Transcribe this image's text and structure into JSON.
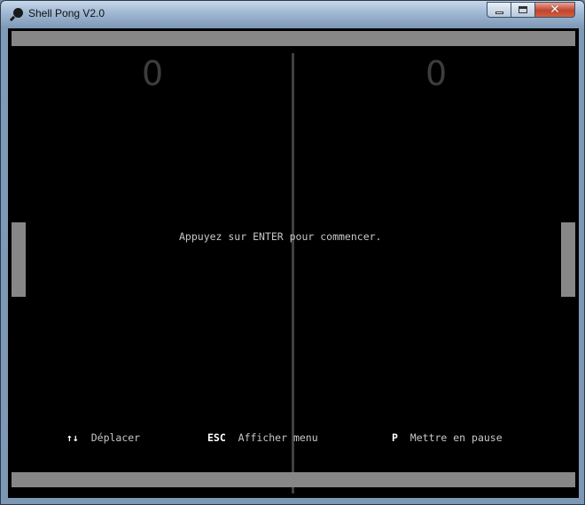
{
  "window": {
    "title": "Shell Pong V2.0",
    "icon": "ping-pong-paddle-icon",
    "controls": {
      "minimize": "minimize-icon",
      "maximize": "maximize-icon",
      "close": "✕"
    }
  },
  "game": {
    "score_left": "0",
    "score_right": "0",
    "message": "Appuyez sur ENTER pour commencer.",
    "help": [
      {
        "key": "↑↓",
        "label": "Déplacer"
      },
      {
        "key": "ESC",
        "label": "Afficher menu"
      },
      {
        "key": "P",
        "label": "Mettre en pause"
      }
    ],
    "colors": {
      "background": "#000000",
      "walls": "#878787",
      "net": "#404040",
      "score": "#3d3d3d",
      "text": "#c8c8c8"
    }
  }
}
